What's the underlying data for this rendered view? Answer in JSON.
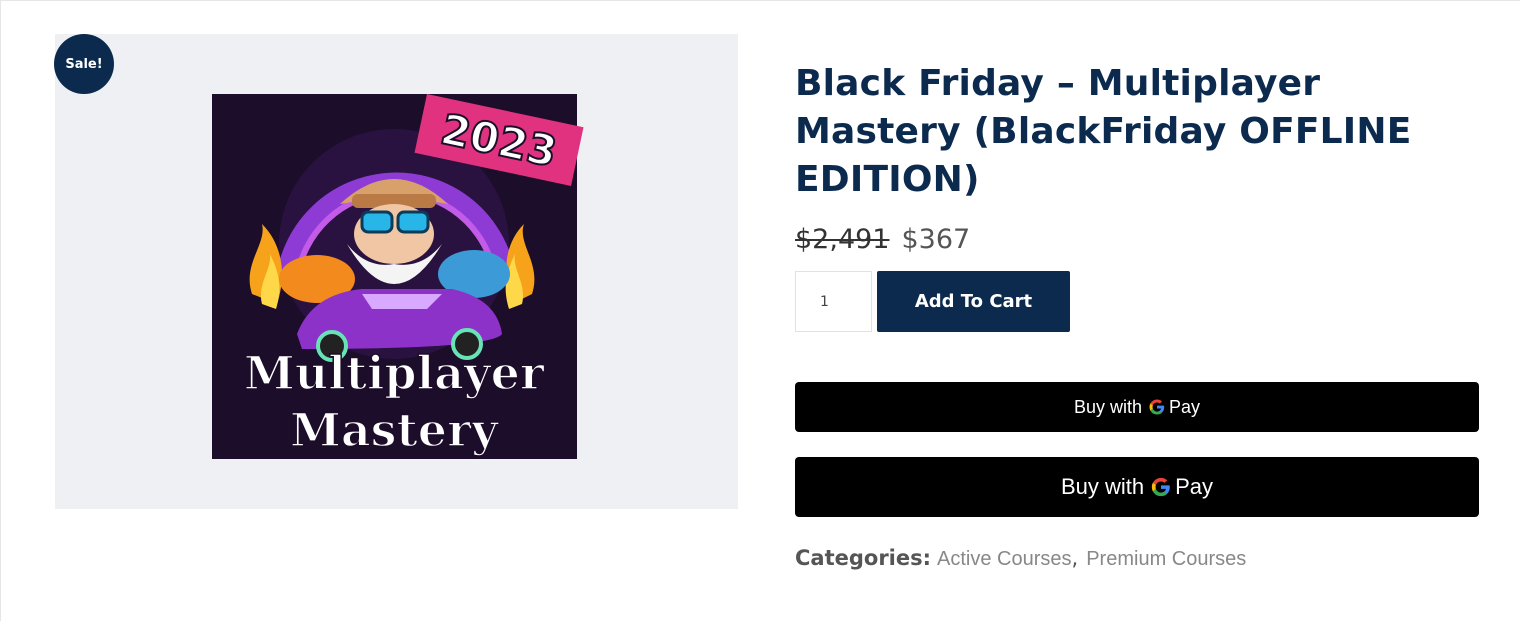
{
  "badge": {
    "sale_label": "Sale!"
  },
  "product": {
    "title": "Black Friday – Multiplayer Mastery (BlackFriday OFFLINE EDITION)",
    "old_price": "$2,491",
    "new_price": "$367",
    "image": {
      "year_ribbon": "2023",
      "headline_line1": "Multiplayer",
      "headline_line2": "Mastery"
    }
  },
  "cart": {
    "quantity": "1",
    "add_to_cart_label": "Add To Cart"
  },
  "payment": {
    "gpay_small": {
      "buy_with": "Buy with",
      "pay": "Pay"
    },
    "gpay_large": {
      "buy_with": "Buy with",
      "pay": "Pay"
    }
  },
  "categories": {
    "label": "Categories:",
    "items": [
      "Active Courses",
      "Premium Courses"
    ],
    "separator": ","
  },
  "colors": {
    "brand_navy": "#0b2a4e",
    "gallery_bg": "#eef0f3",
    "ribbon_pink": "#e0327e",
    "gpay_button": "#000000"
  }
}
